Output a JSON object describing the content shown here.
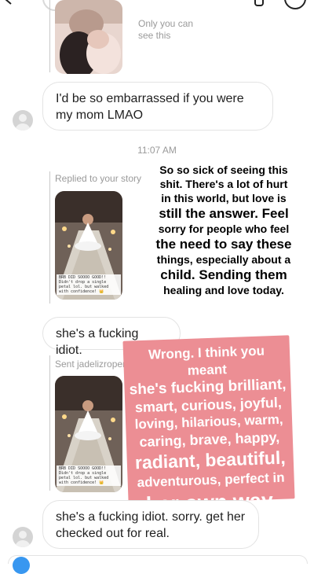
{
  "header": {
    "back_icon": "chevron-left-icon",
    "call_icon": "phone-icon",
    "info_icon": "info-icon"
  },
  "first_story": {
    "caption": "Only you can see this"
  },
  "messages": {
    "m1": "I'd be so embarrassed if you were my mom LMAO",
    "timestamp": "11:07 AM",
    "replied_label": "Replied to your story",
    "m2": "she's a fucking idiot.",
    "sent_label": "Sent jadelizroper",
    "m3": "she's a fucking idiot. sorry. get her checked out for real."
  },
  "story_overlay": {
    "line1": "So so sick of seeing this",
    "line2": "shit. There's a lot of hurt",
    "line3": "in this world, but love is",
    "line4": "still the answer. Feel",
    "line5": "sorry for people who feel",
    "line6": "the need to say these",
    "line7": "things, especially about a",
    "line8": "child. Sending them",
    "line9": "healing and love today."
  },
  "thumb_caption": "BRB DID SOOOO GOOD!! Didn't drop a single petal lol. but walked with confidence! 👑",
  "pink_card": {
    "l1": "Wrong. I think you meant",
    "l2": "she's fucking brilliant,",
    "l3": "smart, curious, joyful,",
    "l4": "loving, hilarious, warm,",
    "l5": "caring, brave, happy,",
    "l6": "radiant, beautiful,",
    "l7": "adventurous, perfect in",
    "l8": "her own way."
  },
  "colors": {
    "pink": "#ec8e94",
    "bubble_border": "#e3e3e3",
    "grey_text": "#9a9a9a"
  }
}
